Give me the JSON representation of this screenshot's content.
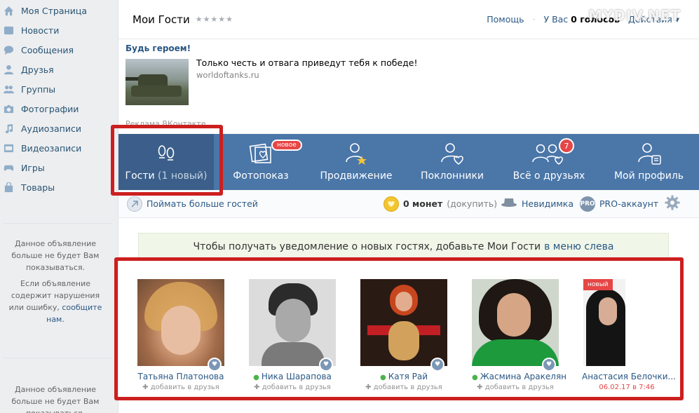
{
  "sidebar": {
    "items": [
      {
        "label": "Моя Страница",
        "icon": "home-icon"
      },
      {
        "label": "Новости",
        "icon": "news-icon"
      },
      {
        "label": "Сообщения",
        "icon": "messages-icon"
      },
      {
        "label": "Друзья",
        "icon": "friends-icon"
      },
      {
        "label": "Группы",
        "icon": "groups-icon"
      },
      {
        "label": "Фотографии",
        "icon": "camera-icon"
      },
      {
        "label": "Аудиозаписи",
        "icon": "music-icon"
      },
      {
        "label": "Видеозаписи",
        "icon": "video-icon"
      },
      {
        "label": "Игры",
        "icon": "gamepad-icon"
      },
      {
        "label": "Товары",
        "icon": "bag-icon"
      }
    ],
    "ad1": {
      "line1": "Данное объявление больше не будет Вам показываться.",
      "line2_prefix": "Если объявление содержит нарушения или ошибку,",
      "line2_link": "сообщите нам."
    },
    "ad2": {
      "line1": "Данное объявление больше не будет Вам показываться."
    }
  },
  "header": {
    "title": "Мои Гости",
    "rating": "★★★★★",
    "help": "Помощь",
    "votes_prefix": "У Вас",
    "votes_count": "0 голосов",
    "actions": "Действия ▾",
    "watermark": "MYDIV.NET"
  },
  "promo": {
    "heading": "Будь героем!",
    "text": "Только честь и отвага приведут тебя к победе!",
    "site": "worldoftanks.ru",
    "footer": "Реклама ВКонтакте"
  },
  "tabs": [
    {
      "label": "Гости",
      "count": "(1 новый)",
      "icon": "footprints-icon",
      "active": true
    },
    {
      "label": "Фотопоказ",
      "badge": "новое",
      "icon": "photo-heart-icon"
    },
    {
      "label": "Продвижение",
      "icon": "user-star-icon"
    },
    {
      "label": "Поклонники",
      "icon": "user-heart-icon"
    },
    {
      "label": "Всё о друзьях",
      "badge": "7",
      "icon": "friends-heart-icon"
    },
    {
      "label": "Мой профиль",
      "icon": "user-card-icon"
    }
  ],
  "subbar": {
    "catch": "Поймать больше гостей",
    "coins": "0 монет",
    "topup": "(докупить)",
    "invisible": "Невидимка",
    "pro": "PRO-аккаунт",
    "pro_badge": "PRO"
  },
  "notice": {
    "text": "Чтобы получать уведомление о новых гостях, добавьте Мои Гости",
    "link": "в меню слева"
  },
  "guests": [
    {
      "name": "Татьяна Платонова",
      "online": false,
      "add": "добавить в друзья"
    },
    {
      "name": "Ника Шарапова",
      "online": true,
      "add": "добавить в друзья"
    },
    {
      "name": "Катя Рай",
      "online": true,
      "add": "добавить в друзья"
    },
    {
      "name": "Жасмина Аракелян",
      "online": true,
      "add": "добавить в друзья"
    },
    {
      "name": "Анастасия Белочки...",
      "online": false,
      "new_tag": "новый",
      "date": "06.02.17 в 7:46"
    }
  ],
  "colors": {
    "brand": "#4a76a8",
    "highlight": "#cc1f1f",
    "link": "#2a5885"
  }
}
